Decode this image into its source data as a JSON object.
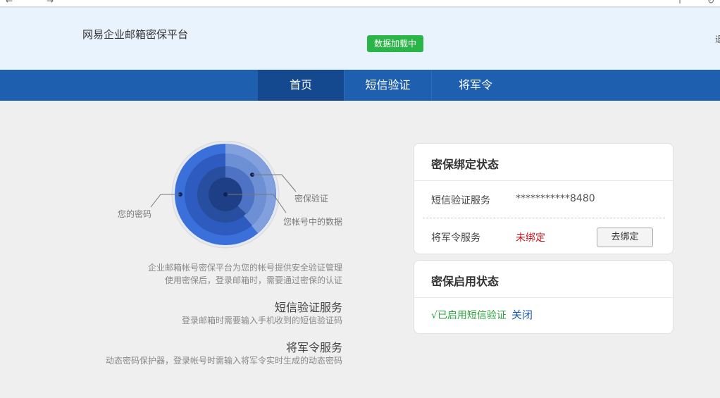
{
  "browser": {
    "fragments": [
      "←",
      "→",
      "↑",
      "↻"
    ]
  },
  "header": {
    "brand": "网易企业邮箱密保平台",
    "loading_badge": "数据加载中",
    "edge_glyph": "退"
  },
  "nav": {
    "tabs": [
      {
        "label": "首页",
        "active": true
      },
      {
        "label": "短信验证",
        "active": false
      },
      {
        "label": "将军令",
        "active": false
      }
    ]
  },
  "illustration": {
    "label_password": "您的密码",
    "label_verify": "密保验证",
    "label_data": "您帐号中的数据",
    "desc_line1": "企业邮箱帐号密保平台为您的帐号提供安全验证管理",
    "desc_line2": "使用密保后，登录邮箱时，需要通过密保的认证"
  },
  "services": [
    {
      "title": "短信验证服务",
      "desc": "登录邮箱时需要输入手机收到的短信验证码"
    },
    {
      "title": "将军令服务",
      "desc": "动态密码保护器，登录帐号时需输入将军令实时生成的动态密码"
    }
  ],
  "binding_card": {
    "title": "密保绑定状态",
    "sms_label": "短信验证服务",
    "sms_value": "***********8480",
    "token_label": "将军令服务",
    "token_value": "未绑定",
    "token_button": "去绑定"
  },
  "enable_card": {
    "title": "密保启用状态",
    "enabled_text": "√已启用短信验证",
    "close_label": "关闭"
  },
  "colors": {
    "nav_bg": "#1f5fb0",
    "nav_active": "#14498f",
    "badge_green": "#2bb548",
    "unbound_red": "#c4161c",
    "enabled_green": "#2aa23d",
    "radar_blue": "#3b6fd9"
  }
}
